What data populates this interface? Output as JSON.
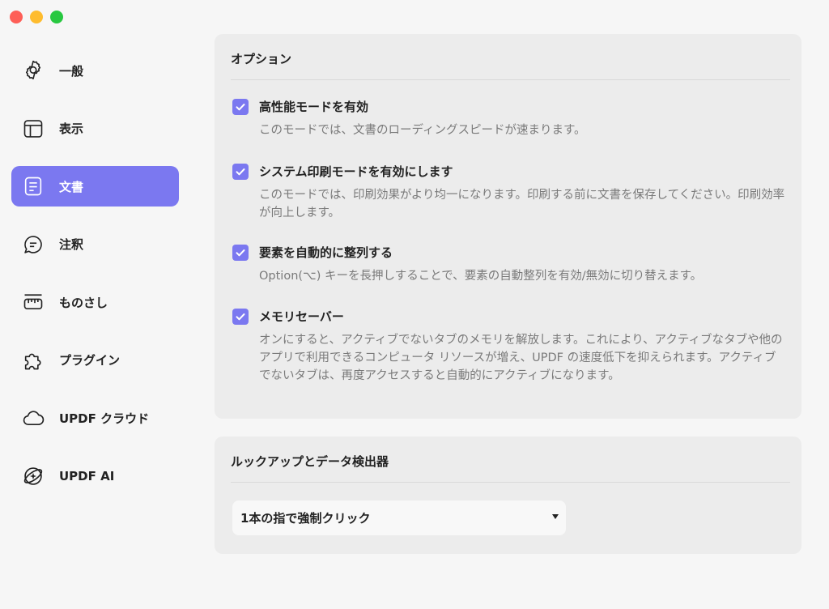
{
  "sidebar": {
    "items": [
      {
        "label": "一般",
        "icon": "gear-icon"
      },
      {
        "label": "表示",
        "icon": "layout-icon"
      },
      {
        "label": "文書",
        "icon": "document-icon",
        "active": true
      },
      {
        "label": "注釈",
        "icon": "comment-icon"
      },
      {
        "label": "ものさし",
        "icon": "ruler-icon"
      },
      {
        "label": "プラグイン",
        "icon": "puzzle-icon"
      },
      {
        "label": "UPDF クラウド",
        "icon": "cloud-icon"
      },
      {
        "label": "UPDF AI",
        "icon": "ai-icon"
      }
    ]
  },
  "options": {
    "title": "オプション",
    "items": [
      {
        "label": "高性能モードを有効",
        "checked": true,
        "desc": "このモードでは、文書のローディングスピードが速まります。"
      },
      {
        "label": "システム印刷モードを有効にします",
        "checked": true,
        "desc": "このモードでは、印刷効果がより均一になります。印刷する前に文書を保存してください。印刷効率が向上します。"
      },
      {
        "label": "要素を自動的に整列する",
        "checked": true,
        "desc": "Option(⌥) キーを長押しすることで、要素の自動整列を有効/無効に切り替えます。"
      },
      {
        "label": "メモリセーバー",
        "checked": true,
        "desc": "オンにすると、アクティブでないタブのメモリを解放します。これにより、アクティブなタブや他のアプリで利用できるコンピュータ リソースが増え、UPDF の速度低下を抑えられます。アクティブでないタブは、再度アクセスすると自動的にアクティブになります。"
      }
    ]
  },
  "lookup": {
    "title": "ルックアップとデータ検出器",
    "select_value": "1本の指で強制クリック"
  },
  "colors": {
    "accent": "#7b78f0",
    "sidebar_bg": "#f6f6f6",
    "panel_bg": "#ececec"
  }
}
